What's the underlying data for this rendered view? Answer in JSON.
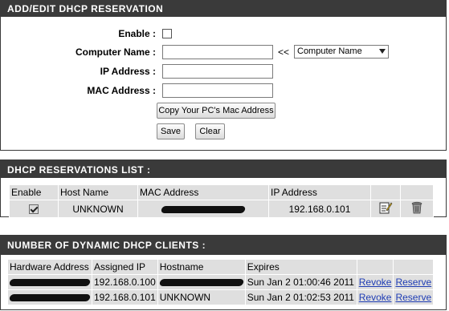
{
  "reservation_form": {
    "title": "ADD/EDIT DHCP RESERVATION",
    "enable_label": "Enable :",
    "enable_checked": false,
    "computer_name_label": "Computer Name :",
    "computer_name_value": "",
    "computer_name_arrows": "<<",
    "computer_name_select": "Computer Name",
    "ip_label": "IP Address :",
    "ip_value": "",
    "mac_label": "MAC Address :",
    "mac_value": "",
    "copy_mac_button": "Copy Your PC's Mac Address",
    "save_button": "Save",
    "clear_button": "Clear"
  },
  "reservations_list": {
    "title": "DHCP RESERVATIONS LIST :",
    "columns": [
      "Enable",
      "Host Name",
      "MAC Address",
      "IP Address"
    ],
    "rows": [
      {
        "enabled": true,
        "host_name": "UNKNOWN",
        "mac": "",
        "ip": "192.168.0.101",
        "edit_icon": "edit-icon",
        "delete_icon": "trash-icon"
      }
    ]
  },
  "dynamic_clients": {
    "title": "NUMBER OF DYNAMIC DHCP CLIENTS :",
    "columns": [
      "Hardware Address",
      "Assigned IP",
      "Hostname",
      "Expires"
    ],
    "rows": [
      {
        "hardware": "",
        "ip": "192.168.0.100",
        "hostname": "",
        "expires": "Sun Jan 2 01:00:46 2011",
        "revoke": "Revoke",
        "reserve": "Reserve"
      },
      {
        "hardware": "",
        "ip": "192.168.0.101",
        "hostname": "UNKNOWN",
        "expires": "Sun Jan 2 01:02:53 2011",
        "revoke": "Revoke",
        "reserve": "Reserve"
      }
    ]
  }
}
